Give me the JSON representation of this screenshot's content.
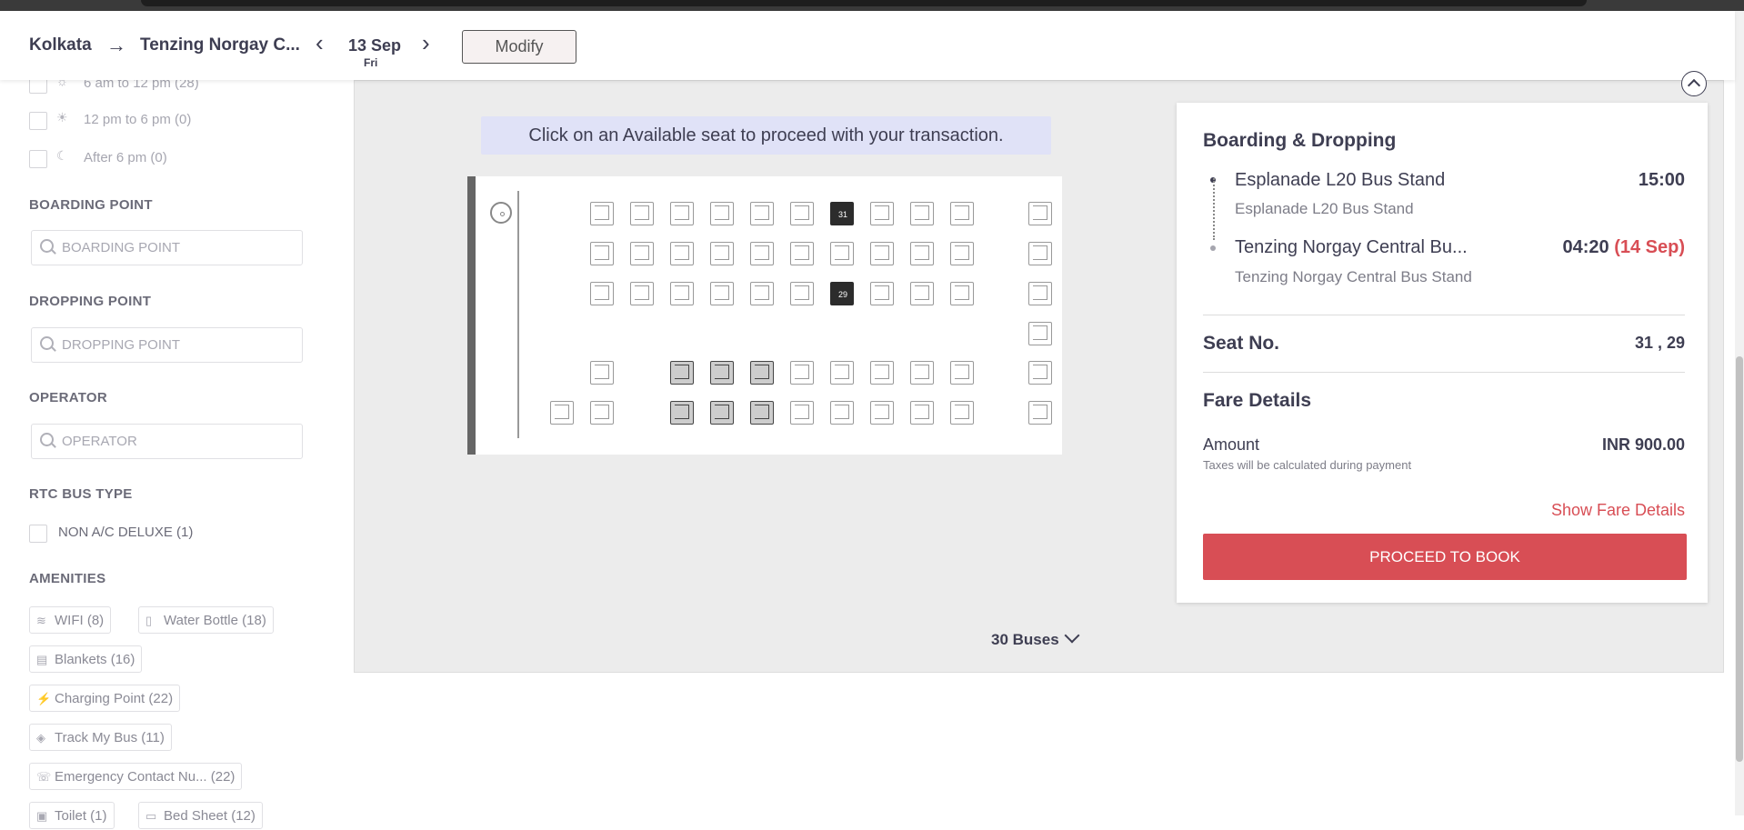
{
  "header": {
    "from": "Kolkata",
    "to": "Tenzing Norgay C...",
    "date": "13 Sep",
    "day": "Fri",
    "modify_label": "Modify"
  },
  "filters": {
    "time_slots": [
      {
        "label": "6 am to 12 pm (28)",
        "icon": "sun-rise-icon"
      },
      {
        "label": "12 pm to 6 pm (0)",
        "icon": "sun-icon"
      },
      {
        "label": "After 6 pm (0)",
        "icon": "sunset-icon"
      }
    ],
    "boarding_title": "BOARDING POINT",
    "boarding_placeholder": "BOARDING POINT",
    "dropping_title": "DROPPING POINT",
    "dropping_placeholder": "DROPPING POINT",
    "operator_title": "OPERATOR",
    "operator_placeholder": "OPERATOR",
    "rtc_title": "RTC BUS TYPE",
    "rtc_option": "NON A/C DELUXE (1)",
    "amenities_title": "AMENITIES",
    "amenities": [
      {
        "label": "WIFI (8)",
        "icon": "wifi-icon"
      },
      {
        "label": "Water Bottle (18)",
        "icon": "bottle-icon"
      },
      {
        "label": "Blankets (16)",
        "icon": "blanket-icon"
      },
      {
        "label": "Charging Point (22)",
        "icon": "plug-icon"
      },
      {
        "label": "Track My Bus (11)",
        "icon": "tracking-icon"
      },
      {
        "label": "Emergency Contact Nu... (22)",
        "icon": "phone-icon"
      },
      {
        "label": "Toilet (1)",
        "icon": "toilet-icon"
      },
      {
        "label": "Bed Sheet (12)",
        "icon": "bedsheet-icon"
      }
    ]
  },
  "seat_layout": {
    "banner": "Click on an Available seat to proceed with your transaction.",
    "selected_seats": [
      "31",
      "29"
    ]
  },
  "buses_toggle": "30 Buses",
  "details": {
    "boarding_title": "Boarding & Dropping",
    "boarding_stop": "Esplanade L20 Bus Stand",
    "boarding_stop_sub": "Esplanade L20 Bus Stand",
    "boarding_time": "15:00",
    "dropping_stop": "Tenzing Norgay Central Bu...",
    "dropping_stop_sub": "Tenzing Norgay Central Bus Stand",
    "dropping_time": "04:20",
    "dropping_date": "(14 Sep)",
    "seat_label": "Seat No.",
    "seat_value": "31 , 29",
    "fare_title": "Fare Details",
    "amount_label": "Amount",
    "amount_value": "INR 900.00",
    "tax_note": "Taxes will be calculated during payment",
    "show_fare_label": "Show Fare Details",
    "proceed_label": "PROCEED TO BOOK"
  },
  "colors": {
    "accent": "#d84e55",
    "banner_bg": "#e0e2f7",
    "selected_seat": "#2c2c2c",
    "booked_seat": "#cdcdcd"
  }
}
